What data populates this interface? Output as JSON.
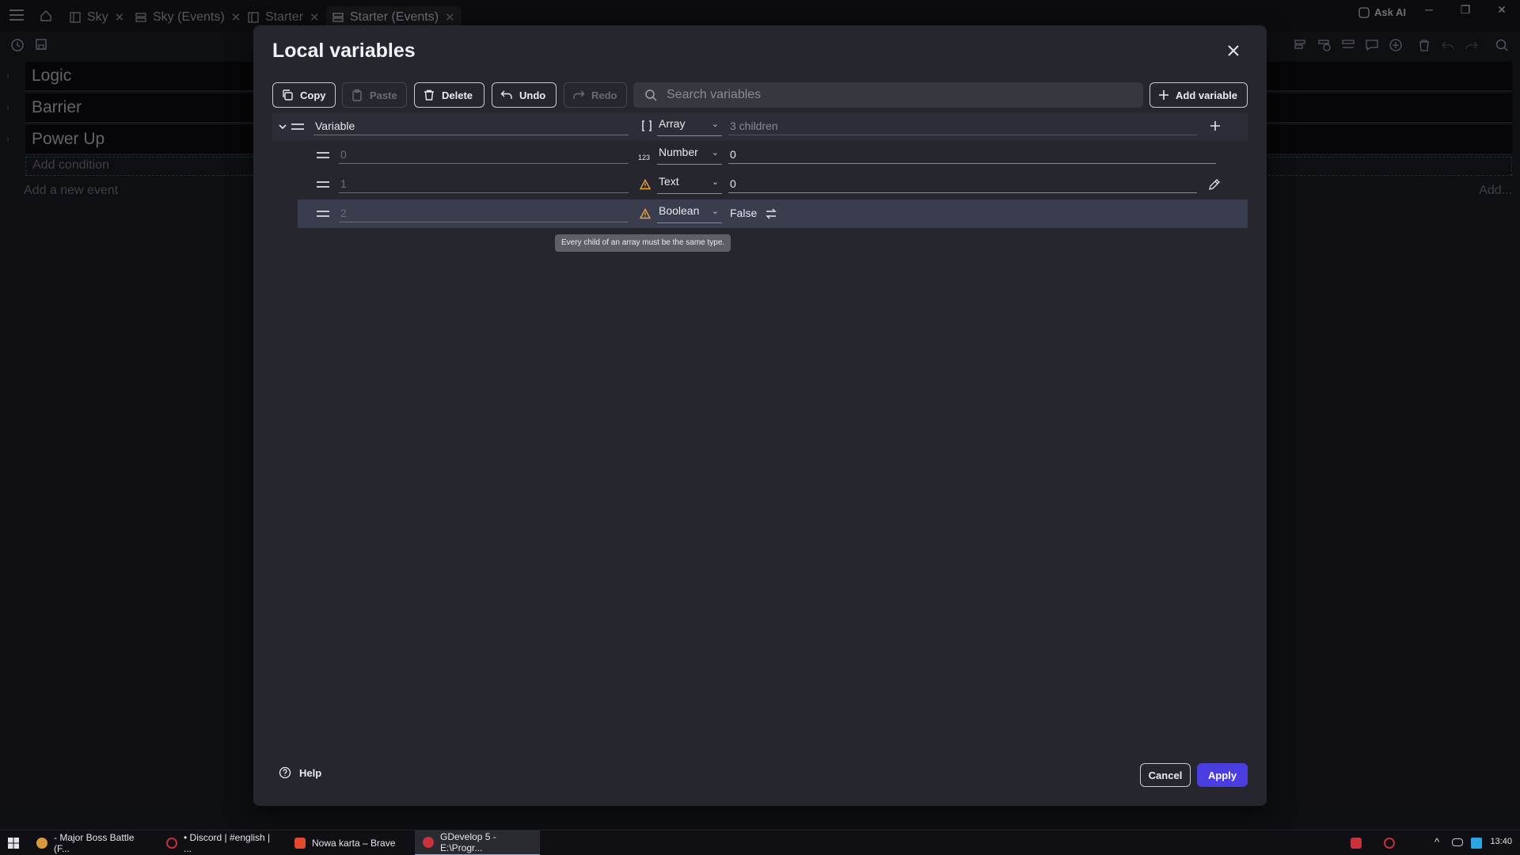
{
  "titlebar": {
    "tabs": [
      {
        "label": "Sky"
      },
      {
        "label": "Sky (Events)"
      },
      {
        "label": "Starter"
      },
      {
        "label": "Starter (Events)"
      }
    ],
    "ask_ai": "Ask AI",
    "window_controls": {
      "minimize": "─",
      "restore": "❐",
      "close": "✕"
    }
  },
  "events": {
    "items": [
      {
        "label": "Logic"
      },
      {
        "label": "Barrier"
      },
      {
        "label": "Power Up"
      }
    ],
    "add_condition": "Add condition",
    "add_event": "Add a new event",
    "add_right": "Add..."
  },
  "dialog": {
    "title": "Local variables",
    "toolbar": {
      "copy": "Copy",
      "paste": "Paste",
      "delete": "Delete",
      "undo": "Undo",
      "redo": "Redo",
      "search_placeholder": "Search variables",
      "add_variable": "Add variable"
    },
    "variables": {
      "root": {
        "name": "Variable",
        "type": "Array",
        "value": "3 children"
      },
      "children": [
        {
          "name": "0",
          "type": "Number",
          "value": "0"
        },
        {
          "name": "1",
          "type": "Text",
          "value": "0"
        },
        {
          "name": "2",
          "type": "Boolean",
          "value": "False"
        }
      ]
    },
    "tooltip": "Every child of an array must be the same type.",
    "help": "Help",
    "cancel": "Cancel",
    "apply": "Apply"
  },
  "taskbar": {
    "items": [
      {
        "label": "- Major Boss Battle (F..."
      },
      {
        "label": "• Discord | #english | ..."
      },
      {
        "label": "Nowa karta – Brave"
      },
      {
        "label": "GDevelop 5 - E:\\Progr..."
      }
    ],
    "clock": "13:40"
  },
  "colors": {
    "accent": "#4b3ee0",
    "warning": "#e8a33c",
    "dialog_bg": "#25262e"
  }
}
